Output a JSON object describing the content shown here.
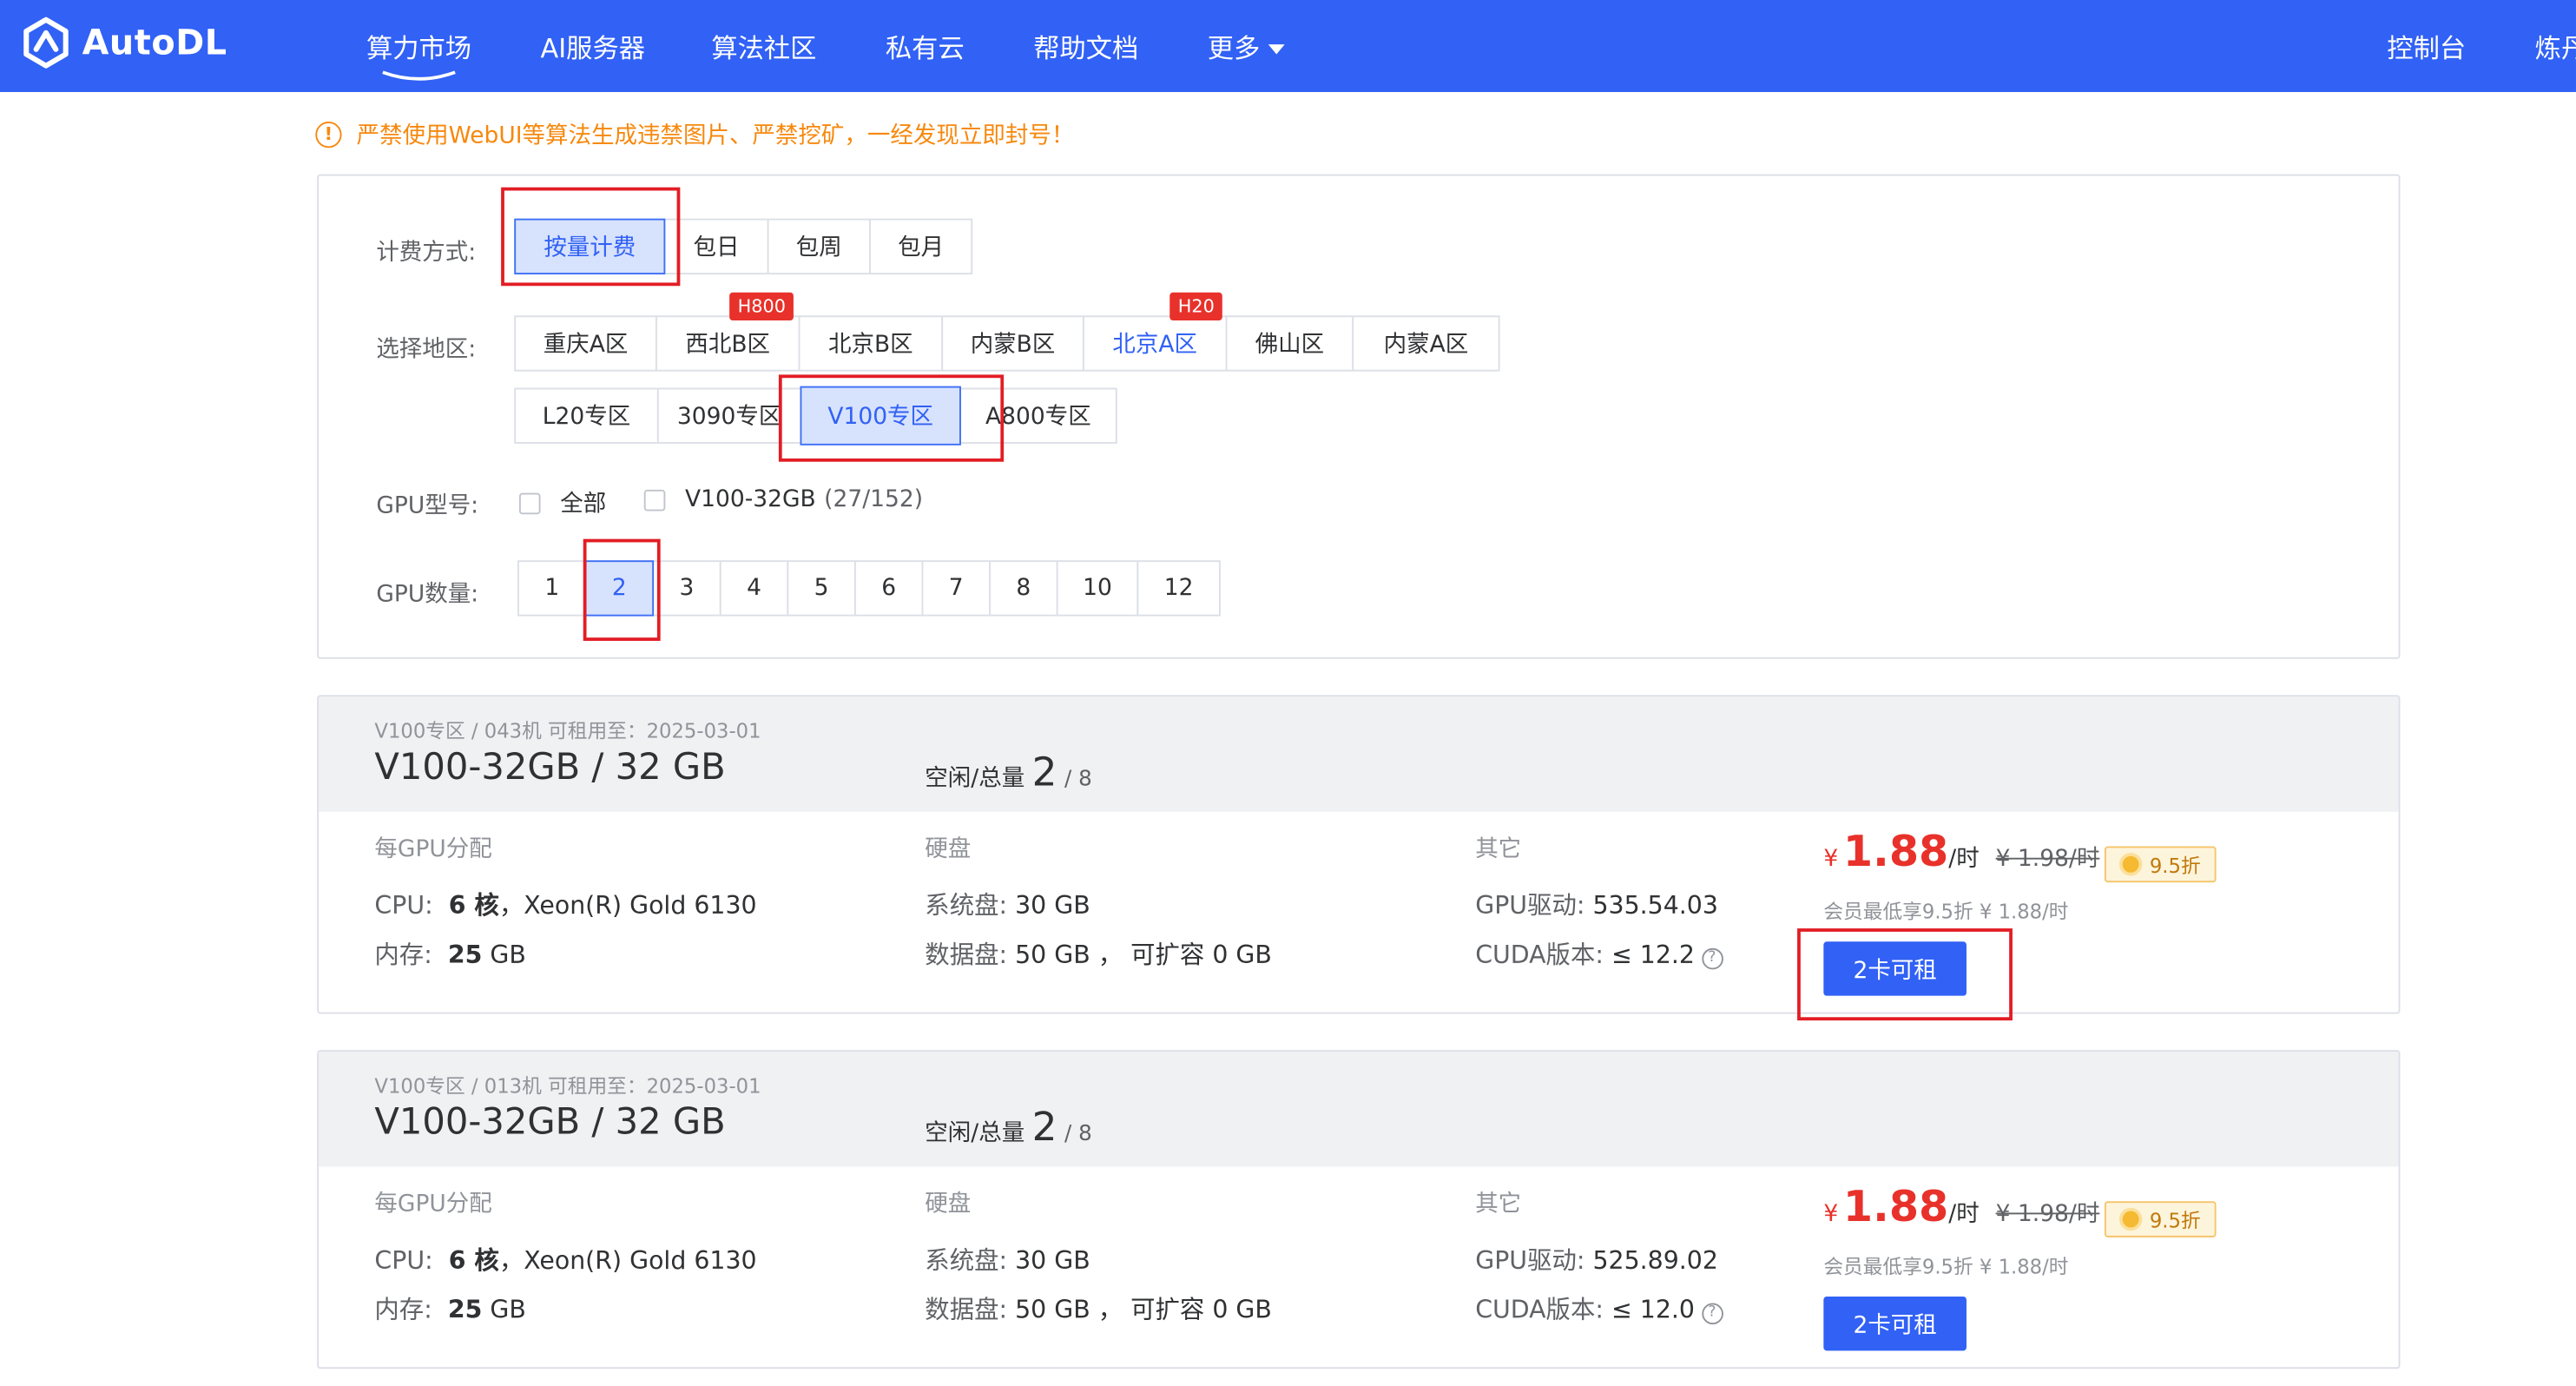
{
  "nav": {
    "logo_text": "AutoDL",
    "items": [
      "算力市场",
      "AI服务器",
      "算法社区",
      "私有云",
      "帮助文档",
      "更多"
    ],
    "console": "控制台",
    "user": "炼丹"
  },
  "warning": {
    "icon": "!",
    "text": "严禁使用WebUI等算法生成违禁图片、严禁挖矿，一经发现立即封号！"
  },
  "filters": {
    "billing": {
      "label": "计费方式:",
      "options": [
        "按量计费",
        "包日",
        "包周",
        "包月"
      ],
      "selected": "按量计费"
    },
    "region": {
      "label": "选择地区:",
      "row1": [
        "重庆A区",
        "西北B区",
        "北京B区",
        "内蒙B区",
        "北京A区",
        "佛山区",
        "内蒙A区"
      ],
      "row2": [
        "L20专区",
        "3090专区",
        "V100专区",
        "A800专区"
      ],
      "badges": {
        "西北B区": "H800",
        "北京A区": "H20"
      },
      "selected": "V100专区"
    },
    "gpu_model": {
      "label": "GPU型号:",
      "options": [
        {
          "name": "全部",
          "count": ""
        },
        {
          "name": "V100-32GB",
          "count": "(27/152)"
        }
      ]
    },
    "gpu_count": {
      "label": "GPU数量:",
      "options": [
        "1",
        "2",
        "3",
        "4",
        "5",
        "6",
        "7",
        "8",
        "10",
        "12"
      ],
      "selected": "2"
    }
  },
  "machines": [
    {
      "meta": "V100专区 / 043机   可租用至：2025-03-01",
      "gpu": "V100-32GB / 32 GB",
      "idle_label": "空闲/总量",
      "idle": "2",
      "total": "/ 8",
      "per_gpu_title": "每GPU分配",
      "cpu_label": "CPU:",
      "cpu_cores": "6 核",
      "cpu_model": "，Xeon(R) Gold 6130",
      "mem_label": "内存:",
      "mem_value": "25",
      "mem_unit": "GB",
      "disk_title": "硬盘",
      "sys_disk_label": "系统盘:",
      "sys_disk": "30 GB",
      "data_disk_label": "数据盘:",
      "data_disk": "50 GB ，",
      "expand": "可扩容 0 GB",
      "other_title": "其它",
      "driver_label": "GPU驱动:",
      "driver": "535.54.03",
      "cuda_label": "CUDA版本:",
      "cuda": "≤ 12.2",
      "price_currency": "¥",
      "price": "1.88",
      "price_unit": "/时",
      "orig_price": "¥ 1.98/时",
      "discount": "9.5折",
      "member_text": "会员最低享9.5折 ¥ 1.88/时",
      "rent_label": "2卡可租"
    },
    {
      "meta": "V100专区 / 013机   可租用至：2025-03-01",
      "gpu": "V100-32GB / 32 GB",
      "idle_label": "空闲/总量",
      "idle": "2",
      "total": "/ 8",
      "per_gpu_title": "每GPU分配",
      "cpu_label": "CPU:",
      "cpu_cores": "6 核",
      "cpu_model": "，Xeon(R) Gold 6130",
      "mem_label": "内存:",
      "mem_value": "25",
      "mem_unit": "GB",
      "disk_title": "硬盘",
      "sys_disk_label": "系统盘:",
      "sys_disk": "30 GB",
      "data_disk_label": "数据盘:",
      "data_disk": "50 GB ，",
      "expand": "可扩容 0 GB",
      "other_title": "其它",
      "driver_label": "GPU驱动:",
      "driver": "525.89.02",
      "cuda_label": "CUDA版本:",
      "cuda": "≤ 12.0",
      "price_currency": "¥",
      "price": "1.88",
      "price_unit": "/时",
      "orig_price": "¥ 1.98/时",
      "discount": "9.5折",
      "member_text": "会员最低享9.5折 ¥ 1.88/时",
      "rent_label": "2卡可租"
    }
  ],
  "colors": {
    "nav_bg": "#3161f5",
    "primary": "#3161f5",
    "price_red": "#e8312a",
    "warning": "#f7880d",
    "highlight_box": "#e21d25"
  }
}
